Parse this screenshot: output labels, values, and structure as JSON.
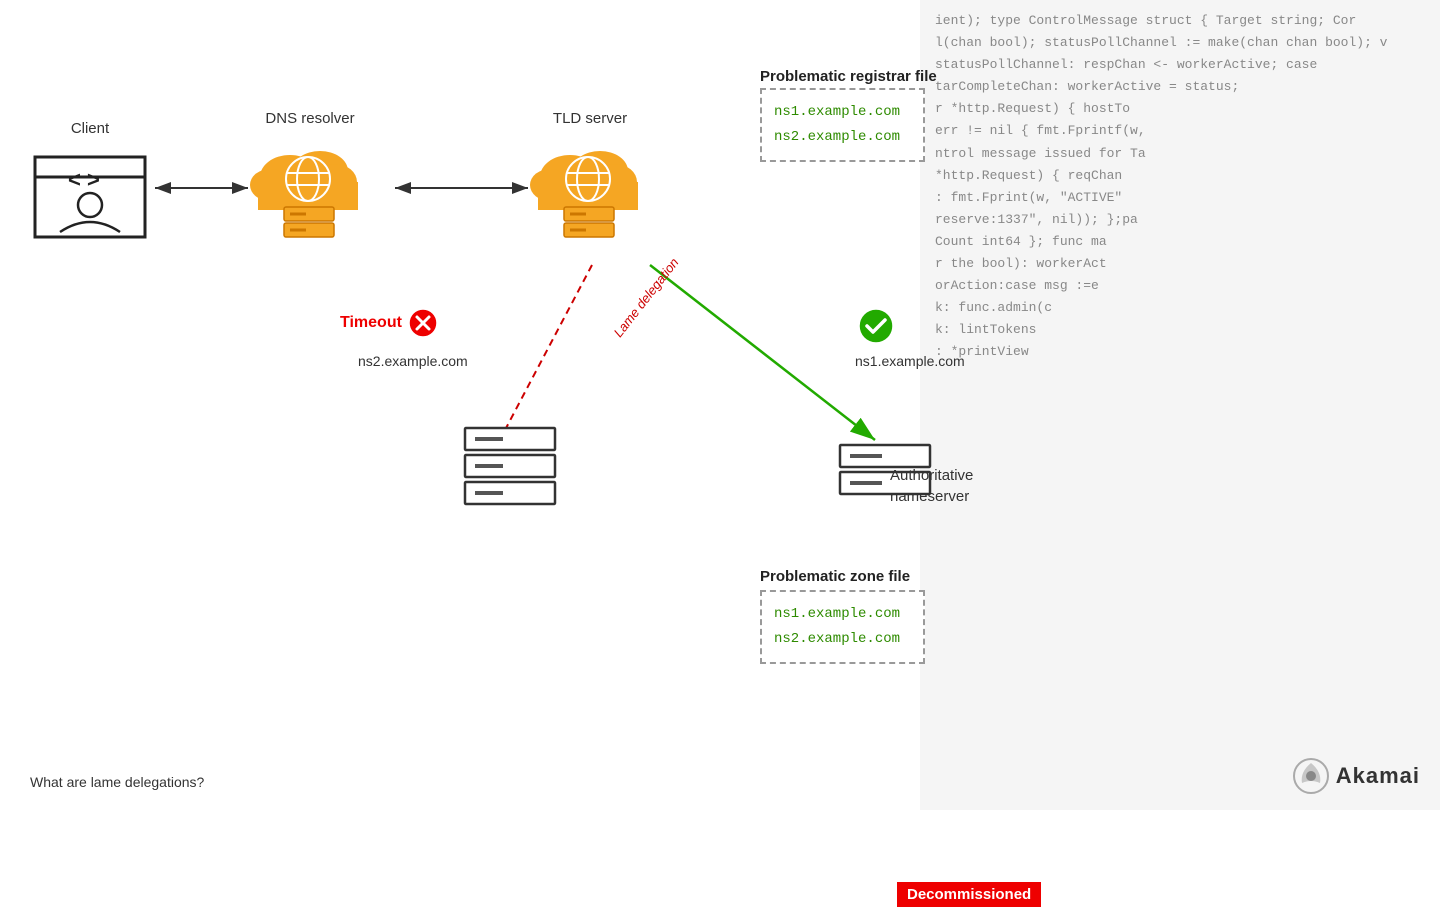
{
  "code_lines": [
    "ient); type ControlMessage struct { Target string; Cor",
    "l(chan bool); statusPollChannel := make(chan chan bool); v",
    "statusPollChannel: respChan <- workerActive; case",
    "tarCompleteChan: workerActive = status;",
    "r *http.Request) { hostTo",
    "err != nil { fmt.Fprintf(w,",
    "ntrol message issued for Ta",
    "*http.Request) { reqChan",
    ": fmt.Fprint(w, \"ACTIVE\"",
    "reserve:1337\", nil)); };pa",
    "Count int64 }; func ma",
    "r the bool): workerAct",
    "orAction:case msg :=e",
    "k: func.admin(c",
    "k: lintTokens",
    ": *printView",
    ""
  ],
  "nodes": {
    "client": {
      "label": "Client"
    },
    "dns_resolver": {
      "label": "DNS resolver"
    },
    "tld_server": {
      "label": "TLD server"
    }
  },
  "registrar": {
    "title": "Problematic registrar file",
    "ns1": "ns1.example.com",
    "ns2": "ns2.example.com"
  },
  "zone": {
    "title": "Problematic zone file",
    "ns1": "ns1.example.com",
    "ns2": "ns2.example.com"
  },
  "labels": {
    "timeout": "Timeout",
    "lame_delegation": "Lame delegation",
    "decommissioned": "Decommissioned",
    "ns2": "ns2.example.com",
    "ns1": "ns1.example.com",
    "authoritative": "Authoritative",
    "nameserver": "nameserver"
  },
  "footer": {
    "question": "What are lame delegations?",
    "brand": "Akamai"
  }
}
